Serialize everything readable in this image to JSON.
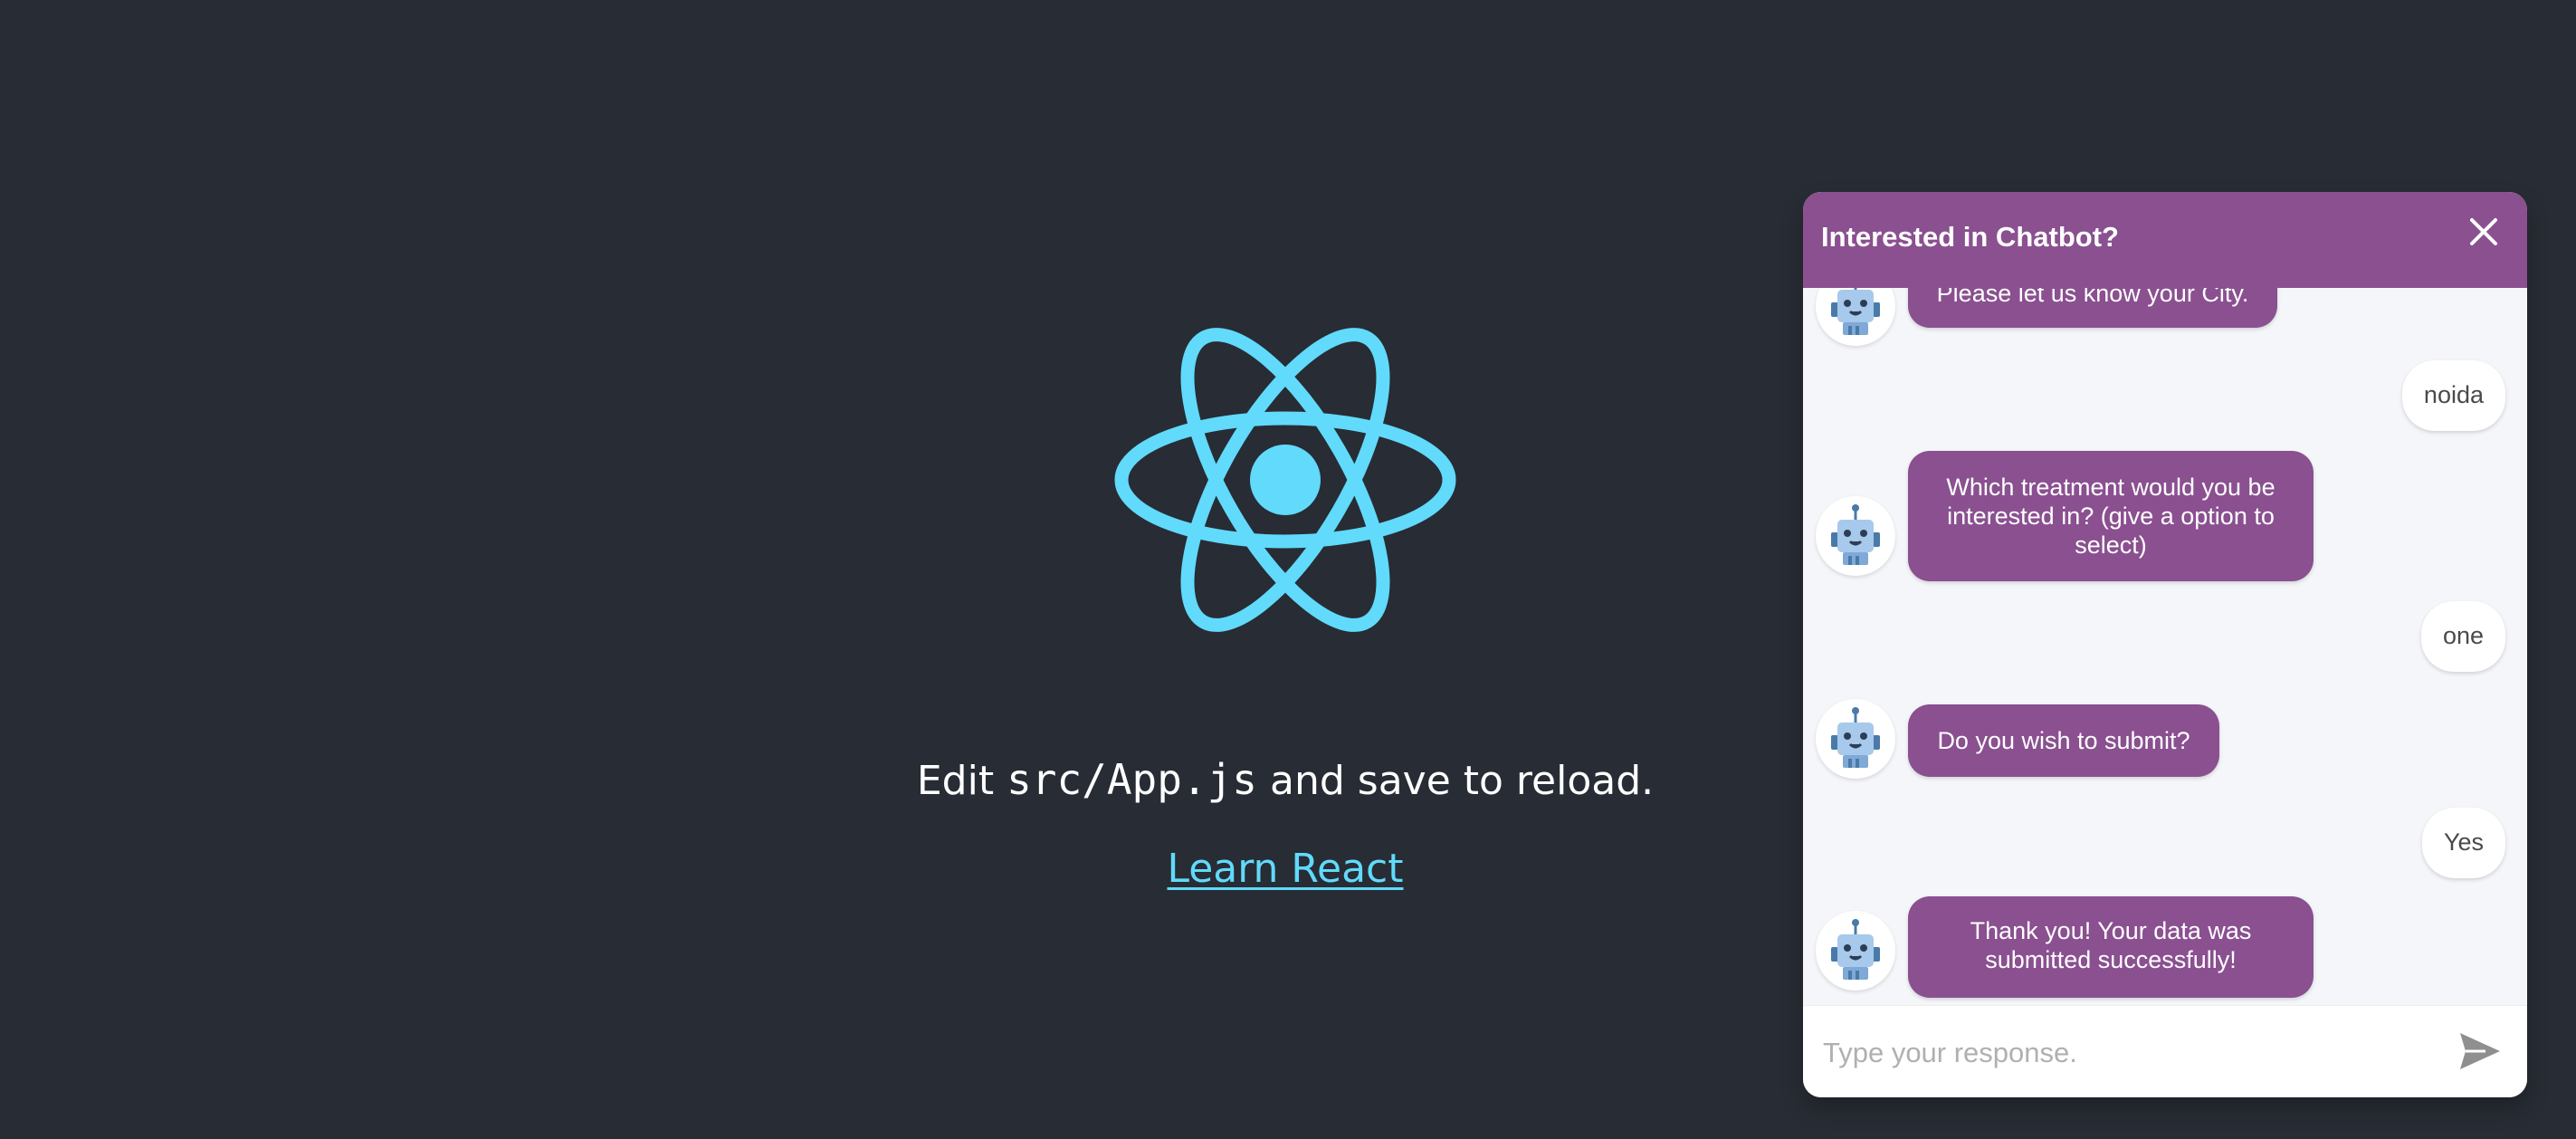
{
  "app": {
    "edit_prefix": "Edit ",
    "edit_code": "src/App.js",
    "edit_suffix": " and save to reload.",
    "learn_link": "Learn React",
    "logo_color": "#61dafb",
    "background": "#282c34",
    "logo_icon": "react-atom-icon"
  },
  "chatbot": {
    "title": "Interested in Chatbot?",
    "close_icon": "close-icon",
    "accent_color": "#8a5090",
    "messages": [
      {
        "from": "bot",
        "text": "Please let us know your City."
      },
      {
        "from": "user",
        "text": "noida"
      },
      {
        "from": "bot",
        "text": "Which treatment would you be interested in? (give a option to select)"
      },
      {
        "from": "user",
        "text": "one"
      },
      {
        "from": "bot",
        "text": "Do you wish to submit?"
      },
      {
        "from": "user",
        "text": "Yes"
      },
      {
        "from": "bot",
        "text": "Thank you! Your data was submitted successfully!"
      }
    ],
    "input": {
      "placeholder": "Type your response.",
      "value": ""
    },
    "send_icon": "send-icon",
    "avatar_icon": "robot-avatar-icon"
  }
}
